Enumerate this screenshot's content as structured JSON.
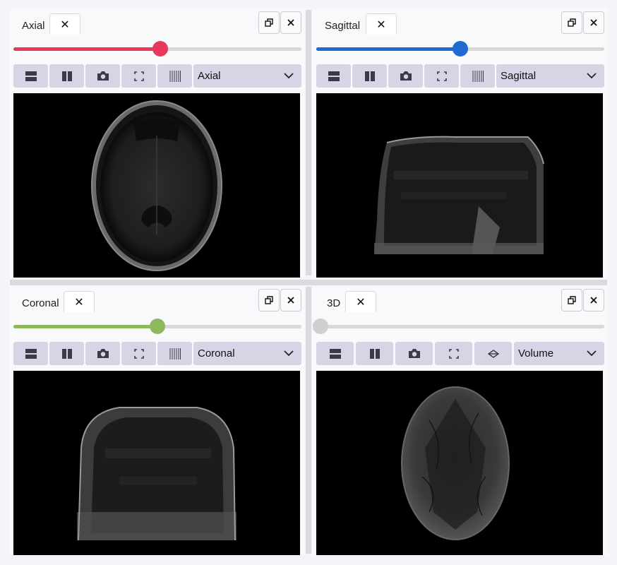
{
  "panels": {
    "axial": {
      "tab_label": "Axial",
      "close_label": "✕",
      "view_select": "Axial",
      "slider_value_pct": 51,
      "accent": "#e8395c"
    },
    "sagittal": {
      "tab_label": "Sagittal",
      "close_label": "✕",
      "view_select": "Sagittal",
      "slider_value_pct": 50,
      "accent": "#1f6bd1"
    },
    "coronal": {
      "tab_label": "Coronal",
      "close_label": "✕",
      "view_select": "Coronal",
      "slider_value_pct": 50,
      "accent": "#8db85b"
    },
    "three_d": {
      "tab_label": "3D",
      "close_label": "✕",
      "view_select": "Volume",
      "slider_value_pct": 0,
      "accent": "#cfcfcf"
    }
  },
  "icons": [
    "rows-layout-icon",
    "columns-layout-icon",
    "camera-icon",
    "fullscreen-icon",
    "slices-icon",
    "axis-icon",
    "chevron-down-icon",
    "restore-window-icon",
    "close-icon"
  ]
}
